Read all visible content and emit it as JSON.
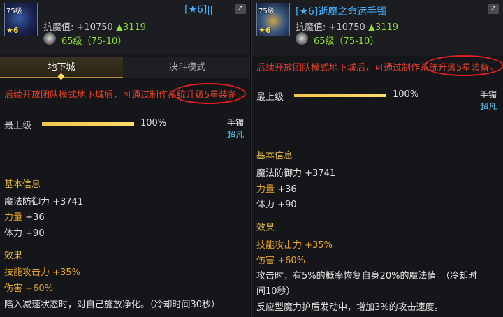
{
  "left": {
    "level_badge": "75级",
    "star_badge": "★6",
    "title": "[★6]",
    "stat_label": "抗魔值:",
    "stat_value": "+10750",
    "stat_up": "▲3119",
    "level_line": "65级（75-10）",
    "tabs": [
      "地下城",
      "决斗模式"
    ],
    "notice": "后续开放团队模式地下城后，可通过制作系统升级5星装备。",
    "max_level_label": "最上级",
    "max_level_pct": "100%",
    "max_level_fill": 1.0,
    "item_type": "手镯",
    "rarity": "超凡",
    "basic_header": "基本信息",
    "stats": [
      {
        "key": "魔法防御力",
        "value": "+3741"
      },
      {
        "key": "力量",
        "value": "+36"
      },
      {
        "key": "体力",
        "value": "+90"
      }
    ],
    "effect_header": "效果",
    "effects": [
      {
        "key": "技能攻击力",
        "value": "+35%"
      },
      {
        "key": "伤害",
        "value": "+60%"
      }
    ],
    "effect_text": "陷入减速状态时，对自己施放净化。（冷却时间30秒）"
  },
  "right": {
    "level_badge": "75级",
    "star_badge": "★6",
    "title": "[★6]逝魔之命运手镯",
    "stat_label": "抗魔值:",
    "stat_value": "+10750",
    "stat_up": "▲3119",
    "level_line": "65级（75-10）",
    "notice": "后续开放团队模式地下城后，可通过制作系统升级5星装备。",
    "max_level_label": "最上级",
    "max_level_pct": "100%",
    "max_level_fill": 1.0,
    "item_type": "手镯",
    "rarity": "超凡",
    "basic_header": "基本信息",
    "stats": [
      {
        "key": "魔法防御力",
        "value": "+3741"
      },
      {
        "key": "力量",
        "value": "+36"
      },
      {
        "key": "体力",
        "value": "+90"
      }
    ],
    "effect_header": "效果",
    "effects": [
      {
        "key": "技能攻击力",
        "value": "+35%"
      },
      {
        "key": "伤害",
        "value": "+60%"
      }
    ],
    "effect_text_1": "攻击时，有5%的概率恢复自身20%的魔法值。（冷却时",
    "effect_text_2": "间10秒）",
    "effect_text_3": "反应型魔力护盾发动中，增加3%的攻击速度。"
  },
  "colors": {
    "notice": "#e4412b",
    "highlight_ring": "#e02020",
    "stat_key": "#e7a52f",
    "rarity": "#5fc9f0",
    "level_green": "#8fdc3f"
  }
}
